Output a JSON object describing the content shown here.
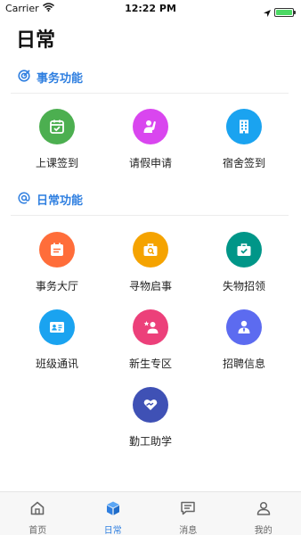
{
  "status_bar": {
    "carrier": "Carrier",
    "time": "12:22 PM",
    "battery_level": 1.0
  },
  "page": {
    "title": "日常"
  },
  "sections": [
    {
      "title": "事务功能",
      "icon": "target-icon",
      "items": [
        {
          "label": "上课签到",
          "icon": "calendar-check-icon",
          "color": "#4caf50"
        },
        {
          "label": "请假申请",
          "icon": "person-raise-hand-icon",
          "color": "#d946ef"
        },
        {
          "label": "宿舍签到",
          "icon": "building-icon",
          "color": "#1aa3f0"
        }
      ]
    },
    {
      "title": "日常功能",
      "icon": "at-sign-icon",
      "items": [
        {
          "label": "事务大厅",
          "icon": "calendar-list-icon",
          "color": "#ff6d3a"
        },
        {
          "label": "寻物启事",
          "icon": "briefcase-search-icon",
          "color": "#f5a300"
        },
        {
          "label": "失物招领",
          "icon": "briefcase-check-icon",
          "color": "#009688"
        },
        {
          "label": "班级通讯",
          "icon": "contact-card-icon",
          "color": "#1aa3f0"
        },
        {
          "label": "新生专区",
          "icon": "person-star-icon",
          "color": "#ec407a"
        },
        {
          "label": "招聘信息",
          "icon": "person-tie-icon",
          "color": "#5c6bf0"
        },
        {
          "label": "勤工助学",
          "icon": "hand-heart-icon",
          "color": "#3f51b5"
        }
      ]
    }
  ],
  "tab_bar": {
    "tabs": [
      {
        "label": "首页",
        "icon": "home-icon"
      },
      {
        "label": "日常",
        "icon": "cube-icon",
        "active": true
      },
      {
        "label": "消息",
        "icon": "message-icon"
      },
      {
        "label": "我的",
        "icon": "person-icon"
      }
    ]
  },
  "colors": {
    "accent": "#2f7fe0",
    "divider": "#ececec",
    "tab_bar_bg": "#f7f7f7"
  }
}
